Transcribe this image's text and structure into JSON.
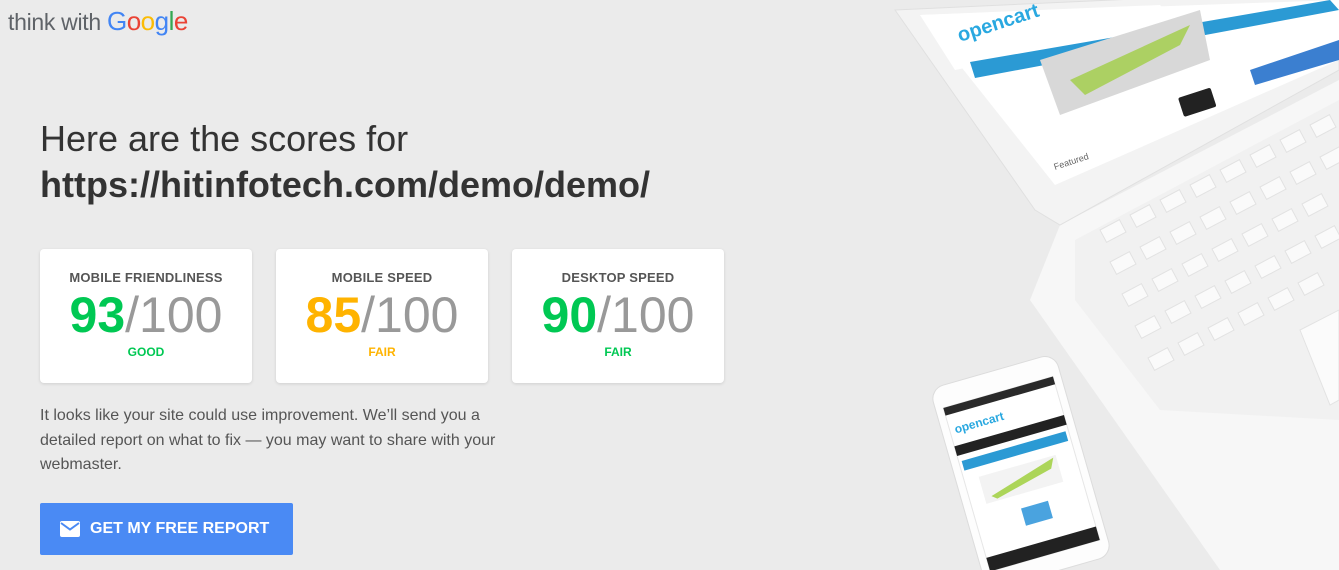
{
  "brand": {
    "prefix": "think with ",
    "google": [
      "G",
      "o",
      "o",
      "g",
      "l",
      "e"
    ]
  },
  "headline": "Here are the scores for",
  "url": "https://hitinfotech.com/demo/demo/",
  "cards": [
    {
      "label": "MOBILE FRIENDLINESS",
      "score": "93",
      "out_of": "/100",
      "rating": "GOOD",
      "color": "#00c853"
    },
    {
      "label": "MOBILE SPEED",
      "score": "85",
      "out_of": "/100",
      "rating": "FAIR",
      "color": "#ffb300"
    },
    {
      "label": "DESKTOP SPEED",
      "score": "90",
      "out_of": "/100",
      "rating": "FAIR",
      "color": "#00c853"
    }
  ],
  "description": "It looks like your site could use improvement. We’ll send you a detailed report on what to fix — you may want to share with your webmaster.",
  "cta": {
    "label": "GET MY FREE REPORT",
    "icon": "mail-icon"
  },
  "device_screens": {
    "brand": "opencart",
    "featured": "Featured"
  }
}
